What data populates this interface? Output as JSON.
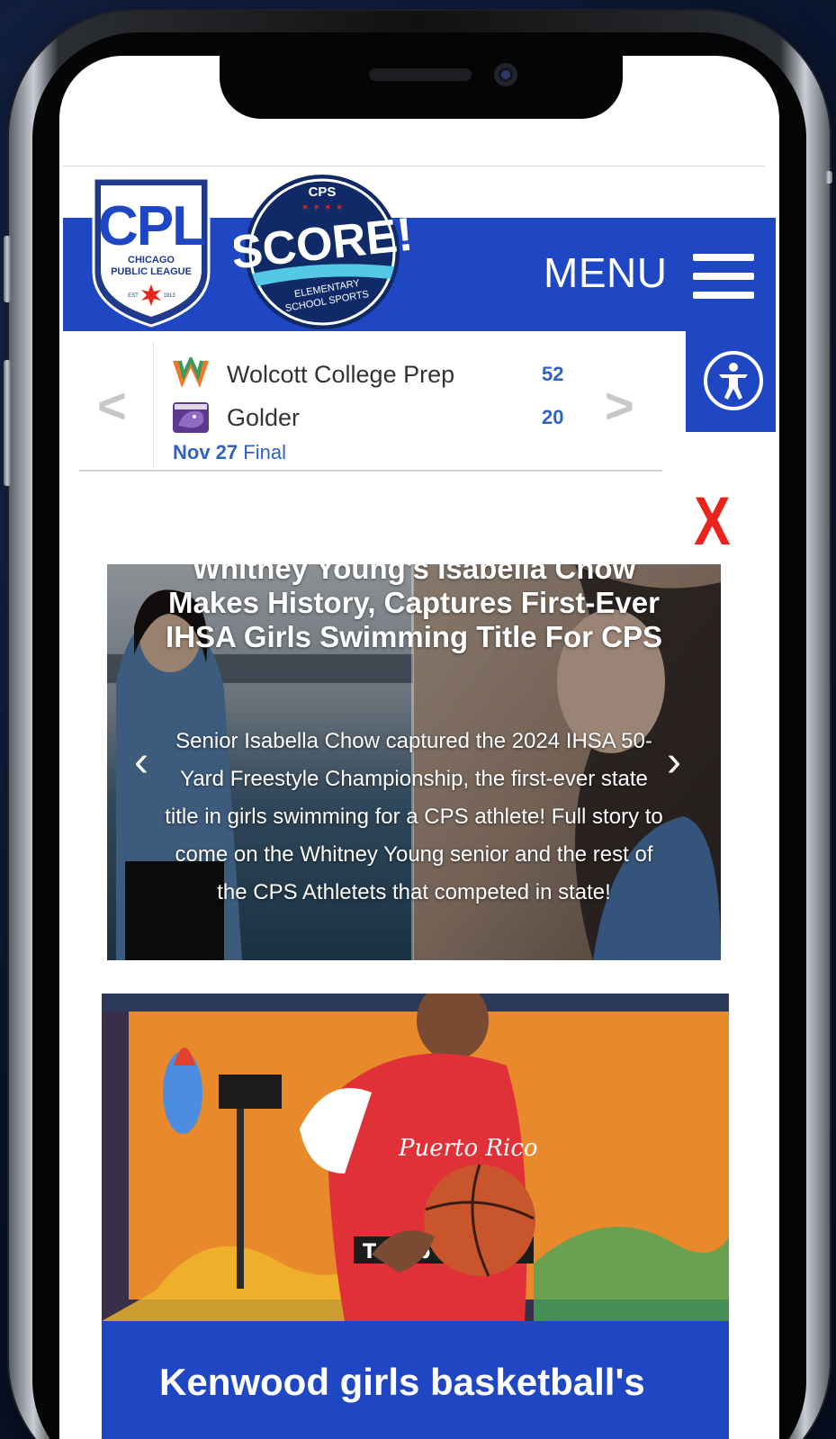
{
  "header": {
    "menu_label": "MENU",
    "cpl_logo": {
      "letters": "CPL",
      "line1": "CHICAGO",
      "line2": "PUBLIC LEAGUE",
      "est_left": "EST",
      "est_right": "1913"
    },
    "score_logo": {
      "top": "CPS",
      "word": "SCORE!",
      "line1": "ELEMENTARY",
      "line2": "SCHOOL SPORTS"
    }
  },
  "scoreboard": {
    "prev_label": "<",
    "next_label": ">",
    "teams": [
      {
        "name": "Wolcott College Prep",
        "score": "52",
        "logo": "wolcott-w-logo"
      },
      {
        "name": "Golder",
        "score": "20",
        "logo": "panthers-logo"
      }
    ],
    "date": "Nov 27",
    "status": "Final"
  },
  "close_label": "X",
  "slider": {
    "title": "Whitney Young's Isabella Chow Makes History, Captures First-Ever IHSA Girls Swimming Title For CPS",
    "text": "Senior Isabella Chow captured the 2024 IHSA 50-Yard Freestyle Championship, the first-ever state title in girls swimming for a CPS athlete! Full story to come on the Whitney Young senior and the rest of the CPS Athletets that competed in state!",
    "prev_label": "‹",
    "next_label": "›"
  },
  "news_card": {
    "title": "Kenwood girls basketball's",
    "jersey_text": "Puerto Rico",
    "sponsor_text": "T Mob"
  },
  "colors": {
    "brand_blue": "#1f47c4",
    "score_blue": "#2f62c4",
    "close_red": "#e8241c"
  }
}
